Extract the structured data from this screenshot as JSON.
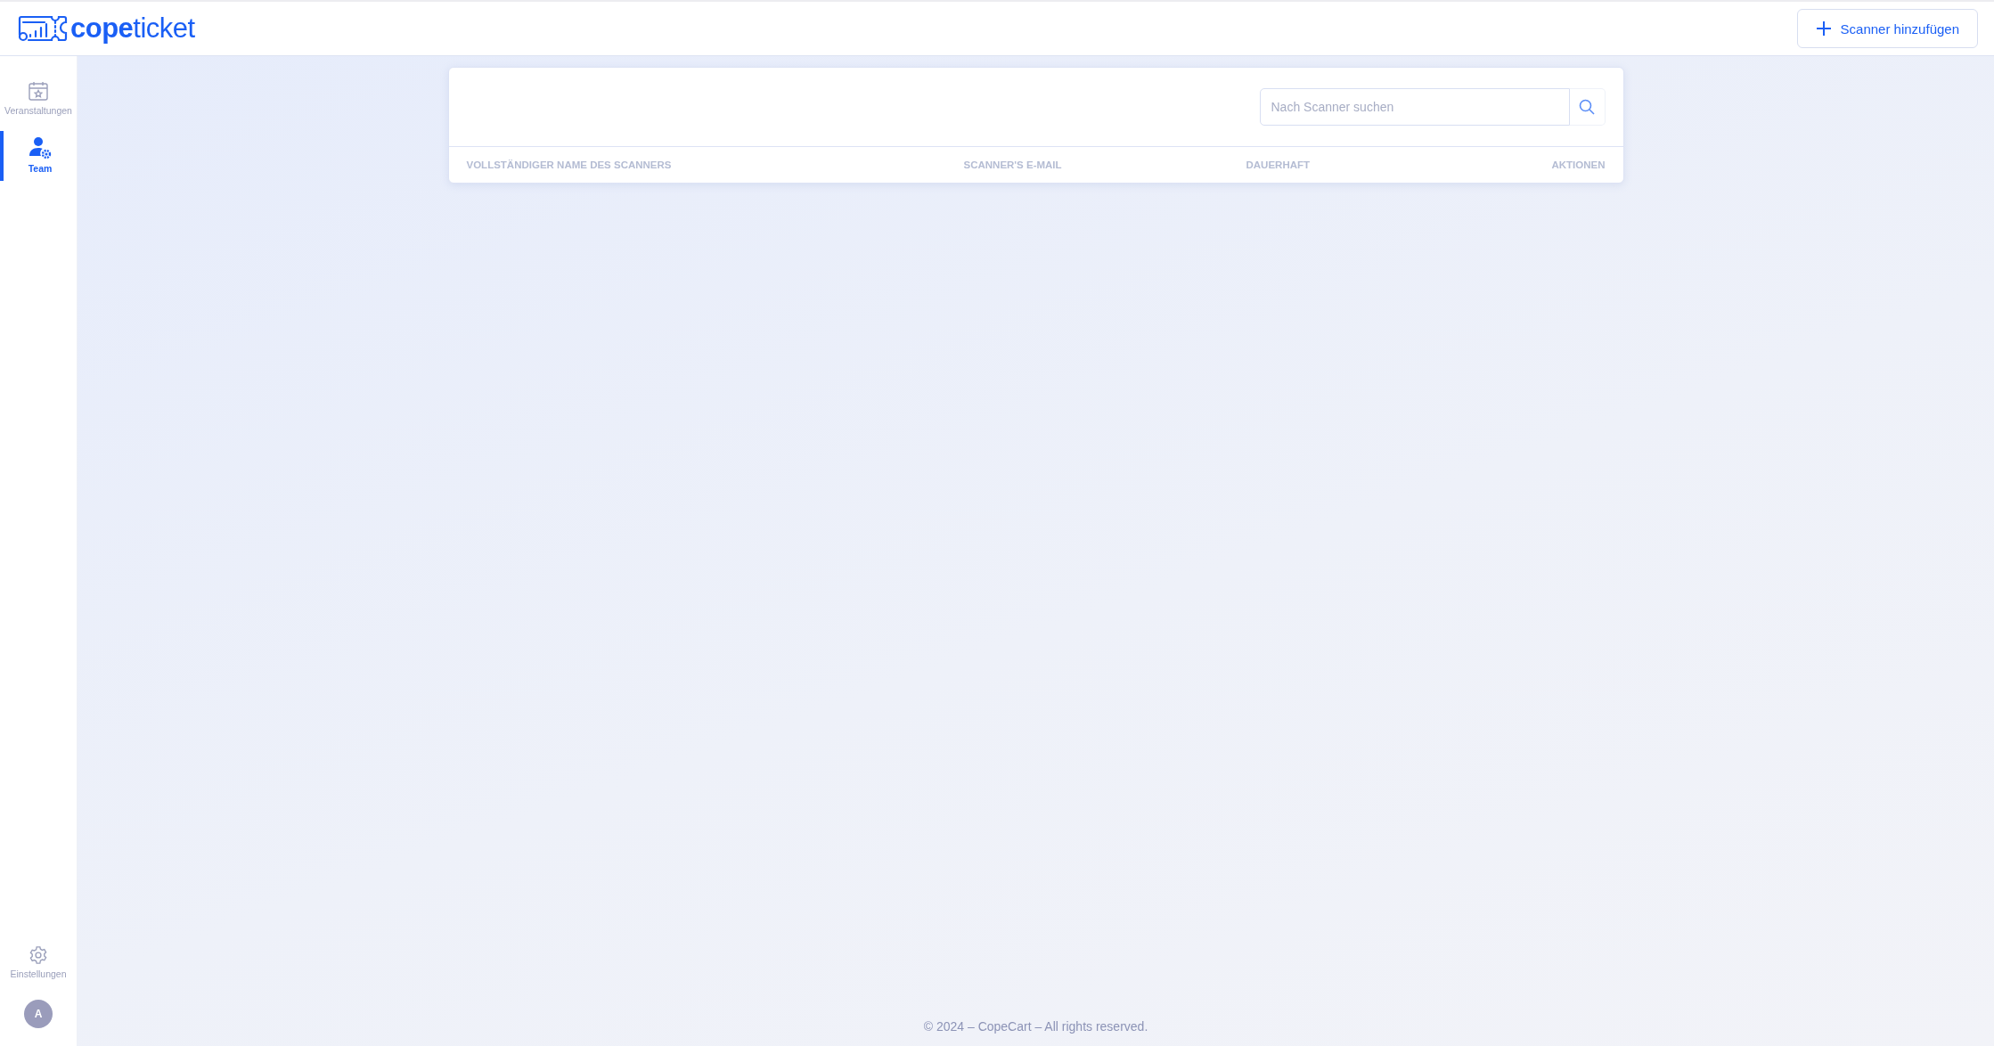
{
  "header": {
    "logo": "**cope**ticket",
    "button": "Scanner hinzufügen"
  },
  "sidebar": {
    "items": [
      {
        "label": "Veranstaltungen",
        "kind": "events",
        "selected": false
      },
      {
        "label": "Team",
        "kind": "team",
        "selected": true
      }
    ],
    "settings": "Einstellungen",
    "avatar": "A"
  },
  "search": {
    "placeholder": "Nach Scanner suchen"
  },
  "table": {
    "columns": [
      "VOLLSTÄNDIGER NAME DES SCANNERS",
      "SCANNER'S E-MAIL",
      "DAUERHAFT",
      "AKTIONEN"
    ]
  },
  "footer": "© 2024 – CopeCart – All rights reserved."
}
